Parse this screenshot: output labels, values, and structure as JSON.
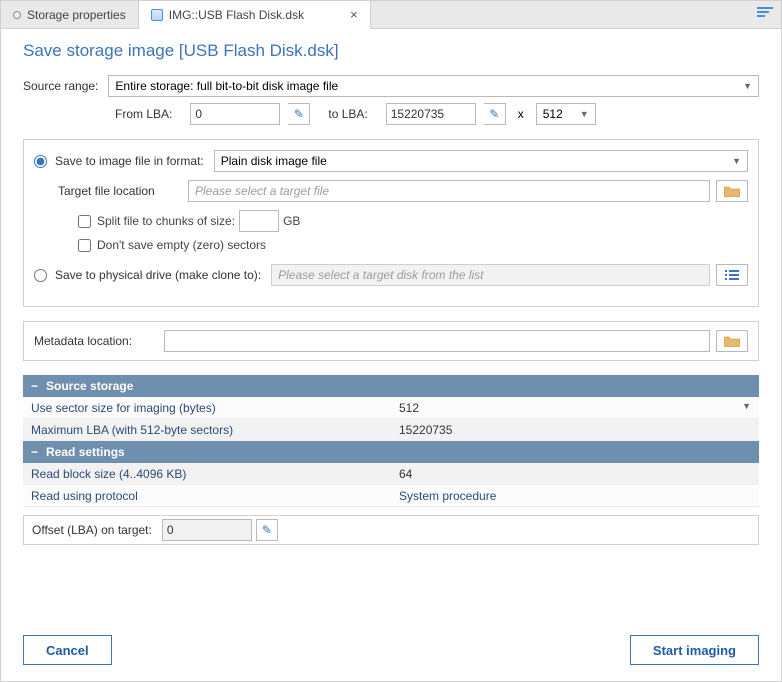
{
  "tabs": {
    "storage_props": "Storage properties",
    "active": "IMG::USB Flash Disk.dsk"
  },
  "title": "Save storage image [USB Flash Disk.dsk]",
  "source": {
    "label": "Source range:",
    "value": "Entire storage: full bit-to-bit disk image file",
    "from_label": "From LBA:",
    "from_value": "0",
    "to_label": "to LBA:",
    "to_value": "15220735",
    "x": "x",
    "sector": "512"
  },
  "save_image": {
    "radio_label": "Save to image file in format:",
    "format": "Plain disk image file",
    "target_label": "Target file location",
    "target_placeholder": "Please select a target file",
    "split_label": "Split file to chunks of size:",
    "split_unit": "GB",
    "zero_label": "Don't save empty (zero) sectors"
  },
  "save_physical": {
    "radio_label": "Save to physical drive (make clone to):",
    "placeholder": "Please select a target disk from the list"
  },
  "metadata": {
    "label": "Metadata location:"
  },
  "sections": {
    "source_storage": "Source storage",
    "sector_size_label": "Use sector size for imaging (bytes)",
    "sector_size_value": "512",
    "max_lba_label": "Maximum LBA (with 512-byte sectors)",
    "max_lba_value": "15220735",
    "read_settings": "Read settings",
    "block_size_label": "Read block size (4..4096 KB)",
    "block_size_value": "64",
    "protocol_label": "Read using protocol",
    "protocol_value": "System procedure"
  },
  "offset": {
    "label": "Offset (LBA) on target:",
    "value": "0"
  },
  "buttons": {
    "cancel": "Cancel",
    "start": "Start imaging"
  }
}
